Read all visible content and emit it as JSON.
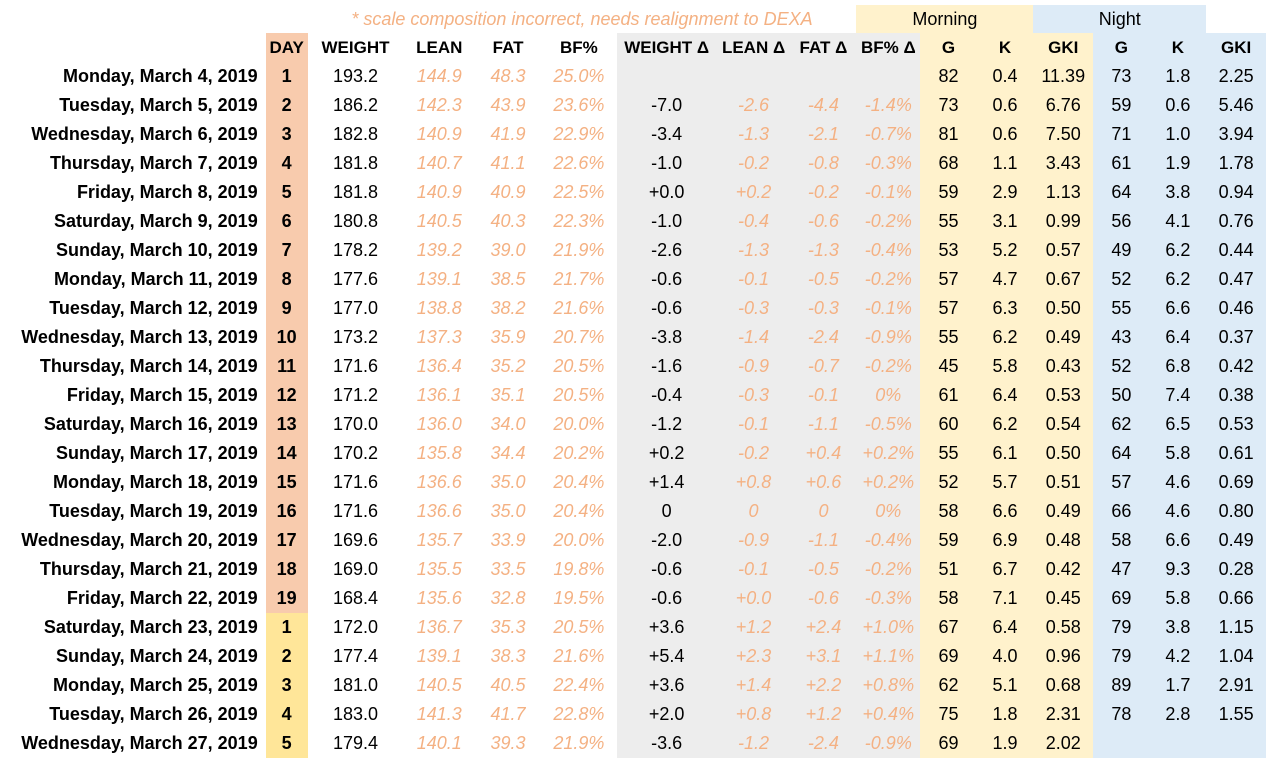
{
  "note": "* scale composition incorrect, needs realignment to DEXA",
  "groups": {
    "morning": "Morning",
    "night": "Night"
  },
  "headers": [
    "DAY",
    "WEIGHT",
    "LEAN",
    "FAT",
    "BF%",
    "WEIGHT Δ",
    "LEAN Δ",
    "FAT Δ",
    "BF% Δ",
    "G",
    "K",
    "GKI",
    "G",
    "K",
    "GKI"
  ],
  "colors": {
    "day_phase1": "#f8cbad",
    "day_phase2": "#ffe699",
    "delta_bg": "#ededed",
    "morning_bg": "#fff2cc",
    "night_bg": "#ddebf7",
    "scale_text": "#f4b183"
  },
  "rows": [
    {
      "date": "Monday, March 4, 2019",
      "day": "1",
      "phase": 1,
      "weight": "193.2",
      "lean": "144.9",
      "fat": "48.3",
      "bf": "25.0%",
      "wd": "",
      "ld": "",
      "fd": "",
      "bfd": "",
      "mg": "82",
      "mk": "0.4",
      "mgki": "11.39",
      "ng": "73",
      "nk": "1.8",
      "ngki": "2.25"
    },
    {
      "date": "Tuesday, March 5, 2019",
      "day": "2",
      "phase": 1,
      "weight": "186.2",
      "lean": "142.3",
      "fat": "43.9",
      "bf": "23.6%",
      "wd": "-7.0",
      "ld": "-2.6",
      "fd": "-4.4",
      "bfd": "-1.4%",
      "mg": "73",
      "mk": "0.6",
      "mgki": "6.76",
      "ng": "59",
      "nk": "0.6",
      "ngki": "5.46"
    },
    {
      "date": "Wednesday, March 6, 2019",
      "day": "3",
      "phase": 1,
      "weight": "182.8",
      "lean": "140.9",
      "fat": "41.9",
      "bf": "22.9%",
      "wd": "-3.4",
      "ld": "-1.3",
      "fd": "-2.1",
      "bfd": "-0.7%",
      "mg": "81",
      "mk": "0.6",
      "mgki": "7.50",
      "ng": "71",
      "nk": "1.0",
      "ngki": "3.94"
    },
    {
      "date": "Thursday, March 7, 2019",
      "day": "4",
      "phase": 1,
      "weight": "181.8",
      "lean": "140.7",
      "fat": "41.1",
      "bf": "22.6%",
      "wd": "-1.0",
      "ld": "-0.2",
      "fd": "-0.8",
      "bfd": "-0.3%",
      "mg": "68",
      "mk": "1.1",
      "mgki": "3.43",
      "ng": "61",
      "nk": "1.9",
      "ngki": "1.78"
    },
    {
      "date": "Friday, March 8, 2019",
      "day": "5",
      "phase": 1,
      "weight": "181.8",
      "lean": "140.9",
      "fat": "40.9",
      "bf": "22.5%",
      "wd": "+0.0",
      "ld": "+0.2",
      "fd": "-0.2",
      "bfd": "-0.1%",
      "mg": "59",
      "mk": "2.9",
      "mgki": "1.13",
      "ng": "64",
      "nk": "3.8",
      "ngki": "0.94"
    },
    {
      "date": "Saturday, March 9, 2019",
      "day": "6",
      "phase": 1,
      "weight": "180.8",
      "lean": "140.5",
      "fat": "40.3",
      "bf": "22.3%",
      "wd": "-1.0",
      "ld": "-0.4",
      "fd": "-0.6",
      "bfd": "-0.2%",
      "mg": "55",
      "mk": "3.1",
      "mgki": "0.99",
      "ng": "56",
      "nk": "4.1",
      "ngki": "0.76"
    },
    {
      "date": "Sunday, March 10, 2019",
      "day": "7",
      "phase": 1,
      "weight": "178.2",
      "lean": "139.2",
      "fat": "39.0",
      "bf": "21.9%",
      "wd": "-2.6",
      "ld": "-1.3",
      "fd": "-1.3",
      "bfd": "-0.4%",
      "mg": "53",
      "mk": "5.2",
      "mgki": "0.57",
      "ng": "49",
      "nk": "6.2",
      "ngki": "0.44"
    },
    {
      "date": "Monday, March 11, 2019",
      "day": "8",
      "phase": 1,
      "weight": "177.6",
      "lean": "139.1",
      "fat": "38.5",
      "bf": "21.7%",
      "wd": "-0.6",
      "ld": "-0.1",
      "fd": "-0.5",
      "bfd": "-0.2%",
      "mg": "57",
      "mk": "4.7",
      "mgki": "0.67",
      "ng": "52",
      "nk": "6.2",
      "ngki": "0.47"
    },
    {
      "date": "Tuesday, March 12, 2019",
      "day": "9",
      "phase": 1,
      "weight": "177.0",
      "lean": "138.8",
      "fat": "38.2",
      "bf": "21.6%",
      "wd": "-0.6",
      "ld": "-0.3",
      "fd": "-0.3",
      "bfd": "-0.1%",
      "mg": "57",
      "mk": "6.3",
      "mgki": "0.50",
      "ng": "55",
      "nk": "6.6",
      "ngki": "0.46"
    },
    {
      "date": "Wednesday, March 13, 2019",
      "day": "10",
      "phase": 1,
      "weight": "173.2",
      "lean": "137.3",
      "fat": "35.9",
      "bf": "20.7%",
      "wd": "-3.8",
      "ld": "-1.4",
      "fd": "-2.4",
      "bfd": "-0.9%",
      "mg": "55",
      "mk": "6.2",
      "mgki": "0.49",
      "ng": "43",
      "nk": "6.4",
      "ngki": "0.37"
    },
    {
      "date": "Thursday, March 14, 2019",
      "day": "11",
      "phase": 1,
      "weight": "171.6",
      "lean": "136.4",
      "fat": "35.2",
      "bf": "20.5%",
      "wd": "-1.6",
      "ld": "-0.9",
      "fd": "-0.7",
      "bfd": "-0.2%",
      "mg": "45",
      "mk": "5.8",
      "mgki": "0.43",
      "ng": "52",
      "nk": "6.8",
      "ngki": "0.42"
    },
    {
      "date": "Friday, March 15, 2019",
      "day": "12",
      "phase": 1,
      "weight": "171.2",
      "lean": "136.1",
      "fat": "35.1",
      "bf": "20.5%",
      "wd": "-0.4",
      "ld": "-0.3",
      "fd": "-0.1",
      "bfd": "0%",
      "mg": "61",
      "mk": "6.4",
      "mgki": "0.53",
      "ng": "50",
      "nk": "7.4",
      "ngki": "0.38"
    },
    {
      "date": "Saturday, March 16, 2019",
      "day": "13",
      "phase": 1,
      "weight": "170.0",
      "lean": "136.0",
      "fat": "34.0",
      "bf": "20.0%",
      "wd": "-1.2",
      "ld": "-0.1",
      "fd": "-1.1",
      "bfd": "-0.5%",
      "mg": "60",
      "mk": "6.2",
      "mgki": "0.54",
      "ng": "62",
      "nk": "6.5",
      "ngki": "0.53"
    },
    {
      "date": "Sunday, March 17, 2019",
      "day": "14",
      "phase": 1,
      "weight": "170.2",
      "lean": "135.8",
      "fat": "34.4",
      "bf": "20.2%",
      "wd": "+0.2",
      "ld": "-0.2",
      "fd": "+0.4",
      "bfd": "+0.2%",
      "mg": "55",
      "mk": "6.1",
      "mgki": "0.50",
      "ng": "64",
      "nk": "5.8",
      "ngki": "0.61"
    },
    {
      "date": "Monday, March 18, 2019",
      "day": "15",
      "phase": 1,
      "weight": "171.6",
      "lean": "136.6",
      "fat": "35.0",
      "bf": "20.4%",
      "wd": "+1.4",
      "ld": "+0.8",
      "fd": "+0.6",
      "bfd": "+0.2%",
      "mg": "52",
      "mk": "5.7",
      "mgki": "0.51",
      "ng": "57",
      "nk": "4.6",
      "ngki": "0.69"
    },
    {
      "date": "Tuesday, March 19, 2019",
      "day": "16",
      "phase": 1,
      "weight": "171.6",
      "lean": "136.6",
      "fat": "35.0",
      "bf": "20.4%",
      "wd": "0",
      "ld": "0",
      "fd": "0",
      "bfd": "0%",
      "mg": "58",
      "mk": "6.6",
      "mgki": "0.49",
      "ng": "66",
      "nk": "4.6",
      "ngki": "0.80"
    },
    {
      "date": "Wednesday, March 20, 2019",
      "day": "17",
      "phase": 1,
      "weight": "169.6",
      "lean": "135.7",
      "fat": "33.9",
      "bf": "20.0%",
      "wd": "-2.0",
      "ld": "-0.9",
      "fd": "-1.1",
      "bfd": "-0.4%",
      "mg": "59",
      "mk": "6.9",
      "mgki": "0.48",
      "ng": "58",
      "nk": "6.6",
      "ngki": "0.49"
    },
    {
      "date": "Thursday, March 21, 2019",
      "day": "18",
      "phase": 1,
      "weight": "169.0",
      "lean": "135.5",
      "fat": "33.5",
      "bf": "19.8%",
      "wd": "-0.6",
      "ld": "-0.1",
      "fd": "-0.5",
      "bfd": "-0.2%",
      "mg": "51",
      "mk": "6.7",
      "mgki": "0.42",
      "ng": "47",
      "nk": "9.3",
      "ngki": "0.28"
    },
    {
      "date": "Friday, March 22, 2019",
      "day": "19",
      "phase": 1,
      "weight": "168.4",
      "lean": "135.6",
      "fat": "32.8",
      "bf": "19.5%",
      "wd": "-0.6",
      "ld": "+0.0",
      "fd": "-0.6",
      "bfd": "-0.3%",
      "mg": "58",
      "mk": "7.1",
      "mgki": "0.45",
      "ng": "69",
      "nk": "5.8",
      "ngki": "0.66"
    },
    {
      "date": "Saturday, March 23, 2019",
      "day": "1",
      "phase": 2,
      "weight": "172.0",
      "lean": "136.7",
      "fat": "35.3",
      "bf": "20.5%",
      "wd": "+3.6",
      "ld": "+1.2",
      "fd": "+2.4",
      "bfd": "+1.0%",
      "mg": "67",
      "mk": "6.4",
      "mgki": "0.58",
      "ng": "79",
      "nk": "3.8",
      "ngki": "1.15"
    },
    {
      "date": "Sunday, March 24, 2019",
      "day": "2",
      "phase": 2,
      "weight": "177.4",
      "lean": "139.1",
      "fat": "38.3",
      "bf": "21.6%",
      "wd": "+5.4",
      "ld": "+2.3",
      "fd": "+3.1",
      "bfd": "+1.1%",
      "mg": "69",
      "mk": "4.0",
      "mgki": "0.96",
      "ng": "79",
      "nk": "4.2",
      "ngki": "1.04"
    },
    {
      "date": "Monday, March 25, 2019",
      "day": "3",
      "phase": 2,
      "weight": "181.0",
      "lean": "140.5",
      "fat": "40.5",
      "bf": "22.4%",
      "wd": "+3.6",
      "ld": "+1.4",
      "fd": "+2.2",
      "bfd": "+0.8%",
      "mg": "62",
      "mk": "5.1",
      "mgki": "0.68",
      "ng": "89",
      "nk": "1.7",
      "ngki": "2.91"
    },
    {
      "date": "Tuesday, March 26, 2019",
      "day": "4",
      "phase": 2,
      "weight": "183.0",
      "lean": "141.3",
      "fat": "41.7",
      "bf": "22.8%",
      "wd": "+2.0",
      "ld": "+0.8",
      "fd": "+1.2",
      "bfd": "+0.4%",
      "mg": "75",
      "mk": "1.8",
      "mgki": "2.31",
      "ng": "78",
      "nk": "2.8",
      "ngki": "1.55"
    },
    {
      "date": "Wednesday, March 27, 2019",
      "day": "5",
      "phase": 2,
      "weight": "179.4",
      "lean": "140.1",
      "fat": "39.3",
      "bf": "21.9%",
      "wd": "-3.6",
      "ld": "-1.2",
      "fd": "-2.4",
      "bfd": "-0.9%",
      "mg": "69",
      "mk": "1.9",
      "mgki": "2.02",
      "ng": "",
      "nk": "",
      "ngki": ""
    }
  ]
}
